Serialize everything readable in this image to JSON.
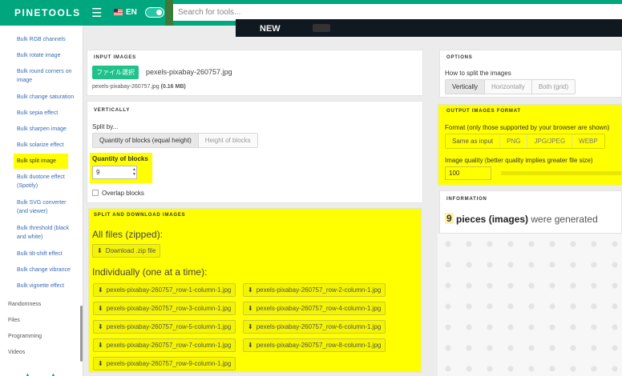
{
  "topbar": {
    "logo": "PINETOOLS",
    "language": "EN",
    "search_placeholder": "Search for tools..."
  },
  "ad": {
    "text": "NEW"
  },
  "sidebar": {
    "items": [
      "Bulk RGB channels",
      "Bulk rotate image",
      "Bulk round corners on image",
      "Bulk change saturation",
      "Bulk sepia effect",
      "Bulk sharpen image",
      "Bulk solarize effect",
      "Bulk split image",
      "Bulk duotone effect (Spotify)",
      "Bulk SVG converter (and viewer)",
      "Bulk threshold (black and white)",
      "Bulk tilt-shift effect",
      "Bulk change vibrance",
      "Bulk vignette effect"
    ],
    "categories": [
      "Randomness",
      "Files",
      "Programming",
      "Videos"
    ]
  },
  "input_images": {
    "title": "INPUT IMAGES",
    "file_button": "ファイル選択",
    "file_name": "pexels-pixabay-260757.jpg",
    "file_info_name": "pexels-pixabay-260757.jpg",
    "file_info_size": "(0.16 MB)"
  },
  "vertically": {
    "title": "VERTICALLY",
    "split_by_label": "Split by...",
    "split_options": [
      "Quantity of blocks (equal height)",
      "Height of blocks"
    ],
    "quantity_label": "Quantity of blocks",
    "quantity_value": "9",
    "overlap_label": "Overlap blocks"
  },
  "split_download": {
    "title": "SPLIT AND DOWNLOAD IMAGES",
    "all_files_label": "All files (zipped):",
    "download_zip": "Download .zip file",
    "individually_label": "Individually (one at a time):",
    "files": [
      "pexels-pixabay-260757_row-1-column-1.jpg",
      "pexels-pixabay-260757_row-2-column-1.jpg",
      "pexels-pixabay-260757_row-3-column-1.jpg",
      "pexels-pixabay-260757_row-4-column-1.jpg",
      "pexels-pixabay-260757_row-5-column-1.jpg",
      "pexels-pixabay-260757_row-6-column-1.jpg",
      "pexels-pixabay-260757_row-7-column-1.jpg",
      "pexels-pixabay-260757_row-8-column-1.jpg",
      "pexels-pixabay-260757_row-9-column-1.jpg"
    ]
  },
  "options": {
    "title": "OPTIONS",
    "how_label": "How to split the images",
    "modes": [
      "Vertically",
      "Horizontally",
      "Both (grid)"
    ]
  },
  "output_format": {
    "title": "OUTPUT IMAGES FORMAT",
    "format_label": "Format (only those supported by your browser are shown)",
    "formats": [
      "Same as input",
      "PNG",
      "JPG/JPEG",
      "WEBP"
    ],
    "quality_label": "Image quality (better quality implies greater file size)",
    "quality_value": "100"
  },
  "information": {
    "title": "INFORMATION",
    "count": "9",
    "bold_text": "pieces (images)",
    "rest_text": "were generated"
  },
  "colors": {
    "brand": "#00a67e",
    "highlight": "#ffff00",
    "link": "#3a6bb5"
  }
}
